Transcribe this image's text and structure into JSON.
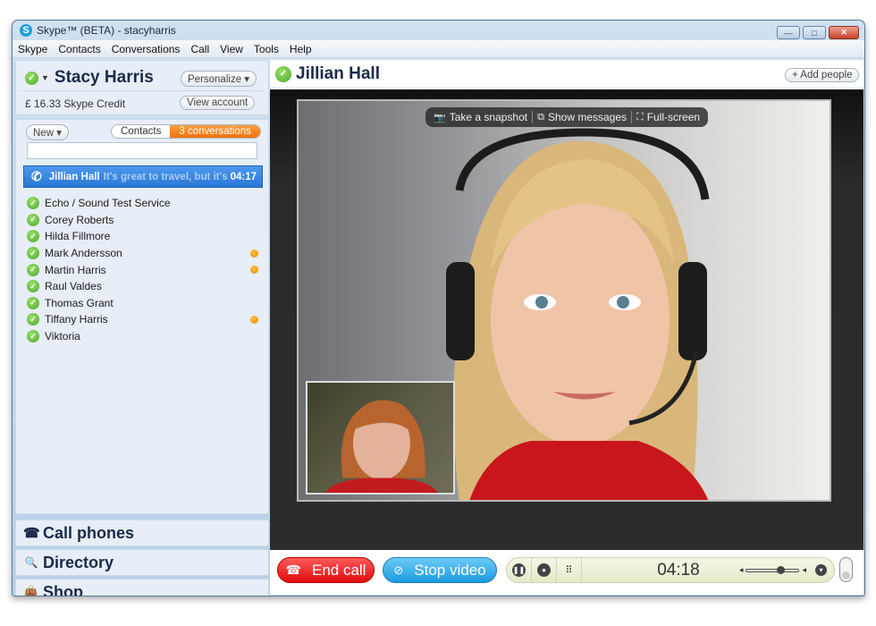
{
  "window": {
    "title": "Skype™ (BETA) - stacyharris",
    "controls": {
      "minimize": "—",
      "maximize": "□",
      "close": "✕"
    }
  },
  "menu": [
    "Skype",
    "Contacts",
    "Conversations",
    "Call",
    "View",
    "Tools",
    "Help"
  ],
  "profile": {
    "name": "Stacy Harris",
    "status_icon": "online-check-icon",
    "personalize_label": "Personalize ▾",
    "credit": "£ 16.33 Skype Credit",
    "view_account_label": "View account"
  },
  "contacts_panel": {
    "new_label": "New ▾",
    "tab_contacts": "Contacts",
    "tab_conversations": "3 conversations",
    "search_value": "",
    "active_conversation": {
      "name": "Jillian Hall",
      "message": "It's great to travel, but it's e...",
      "time": "04:17",
      "icon": "phone-icon"
    },
    "contacts": [
      {
        "name": "Echo / Sound Test Service",
        "unread": false
      },
      {
        "name": "Corey Roberts",
        "unread": false
      },
      {
        "name": "Hilda Fillmore",
        "unread": false
      },
      {
        "name": "Mark Andersson",
        "unread": true
      },
      {
        "name": "Martin Harris",
        "unread": true
      },
      {
        "name": "Raul Valdes",
        "unread": false
      },
      {
        "name": "Thomas Grant",
        "unread": false
      },
      {
        "name": "Tiffany Harris",
        "unread": true
      },
      {
        "name": "Viktoria",
        "unread": false
      }
    ]
  },
  "nav": [
    {
      "label": "Call phones",
      "icon": "telephone-icon",
      "glyph": "☎"
    },
    {
      "label": "Directory",
      "icon": "magnifier-icon",
      "glyph": "🔍"
    },
    {
      "label": "Shop",
      "icon": "shopping-bag-icon",
      "glyph": "👜"
    }
  ],
  "conversation": {
    "contact_name": "Jillian Hall",
    "add_people_label": "+ Add people",
    "video_toolbar": {
      "snapshot": "Take a snapshot",
      "show_messages": "Show messages",
      "fullscreen": "Full-screen"
    },
    "call_controls": {
      "end_call": "End call",
      "stop_video": "Stop video",
      "timer": "04:18",
      "volume": 0.65
    }
  }
}
